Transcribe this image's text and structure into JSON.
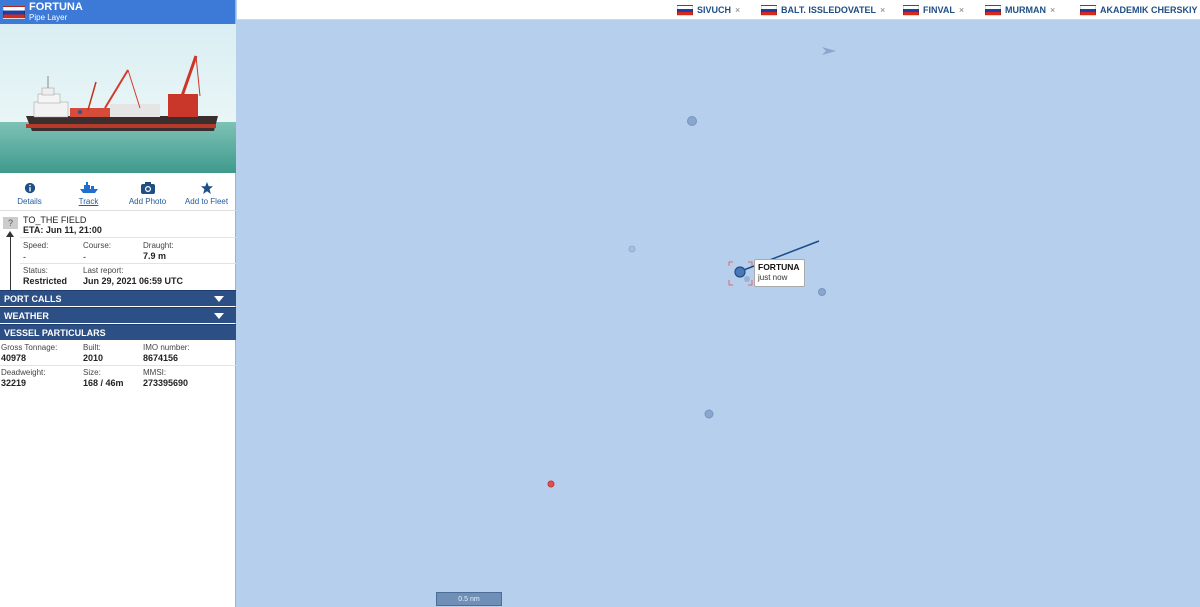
{
  "vessel": {
    "name": "FORTUNA",
    "type": "Pipe Layer",
    "flag_icon": "flag-russia-icon"
  },
  "actions": [
    {
      "label": "Details",
      "icon": "info-icon"
    },
    {
      "label": "Track",
      "icon": "ship-track-icon"
    },
    {
      "label": "Add Photo",
      "icon": "camera-icon"
    },
    {
      "label": "Add to Fleet",
      "icon": "star-icon"
    }
  ],
  "voyage": {
    "unknown_port_mark": "?",
    "destination": "TO_THE FIELD",
    "eta": "ETA: Jun 11, 21:00",
    "speed_label": "Speed:",
    "speed_value": "-",
    "course_label": "Course:",
    "course_value": "-",
    "draught_label": "Draught:",
    "draught_value": "7.9 m",
    "status_label": "Status:",
    "status_value": "Restricted",
    "last_report_label": "Last report:",
    "last_report_value": "Jun 29, 2021 06:59 UTC"
  },
  "sections": {
    "port_calls": "PORT CALLS",
    "weather": "WEATHER",
    "particulars": "VESSEL PARTICULARS"
  },
  "particulars": {
    "gross_tonnage_label": "Gross Tonnage:",
    "gross_tonnage_value": "40978",
    "built_label": "Built:",
    "built_value": "2010",
    "imo_label": "IMO number:",
    "imo_value": "8674156",
    "deadweight_label": "Deadweight:",
    "deadweight_value": "32219",
    "size_label": "Size:",
    "size_value": "168 / 46m",
    "mmsi_label": "MMSI:",
    "mmsi_value": "273395690"
  },
  "tabs": [
    {
      "name": "SIVUCH",
      "close": "×"
    },
    {
      "name": "BALT. ISSLEDOVATEL",
      "close": "×"
    },
    {
      "name": "FINVAL",
      "close": "×"
    },
    {
      "name": "MURMAN",
      "close": "×"
    },
    {
      "name": "AKADEMIK CHERSKIY",
      "close": ""
    }
  ],
  "map": {
    "tooltip_name": "FORTUNA",
    "tooltip_time": "just now",
    "scale_label": "0.5 nm",
    "water_color": "#b6cfec"
  }
}
